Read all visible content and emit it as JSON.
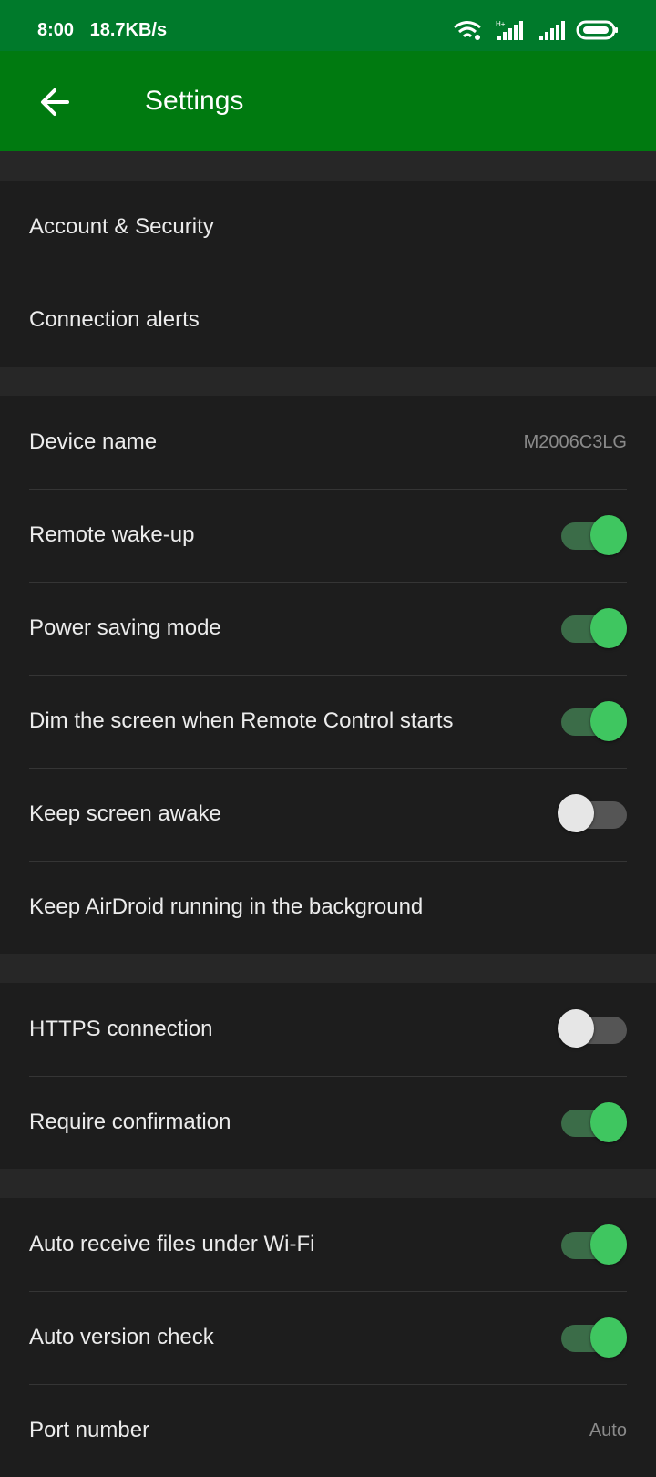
{
  "status_bar": {
    "time": "8:00",
    "speed": "18.7KB/s",
    "icons": [
      "wifi-icon",
      "signal-icon",
      "signal-icon-2",
      "battery-icon"
    ]
  },
  "header": {
    "title": "Settings",
    "back_icon": "arrow-left-icon",
    "color": "#007a10"
  },
  "sections": [
    {
      "rows": [
        {
          "label": "Account & Security"
        },
        {
          "label": "Connection alerts"
        }
      ]
    },
    {
      "rows": [
        {
          "label": "Device name",
          "value": "M2006C3LG"
        },
        {
          "label": "Remote wake-up",
          "toggle": true
        },
        {
          "label": "Power saving mode",
          "toggle": true
        },
        {
          "label": "Dim the screen when Remote Control starts",
          "toggle": true
        },
        {
          "label": "Keep screen awake",
          "toggle": false
        },
        {
          "label": "Keep AirDroid running in the background"
        }
      ]
    },
    {
      "rows": [
        {
          "label": "HTTPS connection",
          "toggle": false
        },
        {
          "label": "Require confirmation",
          "toggle": true
        }
      ]
    },
    {
      "rows": [
        {
          "label": "Auto receive files under Wi-Fi",
          "toggle": true
        },
        {
          "label": "Auto version check",
          "toggle": true
        },
        {
          "label": "Port number",
          "value": "Auto"
        }
      ]
    }
  ],
  "colors": {
    "toggle_on_knob": "#3fc660",
    "toggle_on_track": "#3b6c48",
    "toggle_off_knob": "#e6e6e6",
    "toggle_off_track": "#555555"
  }
}
